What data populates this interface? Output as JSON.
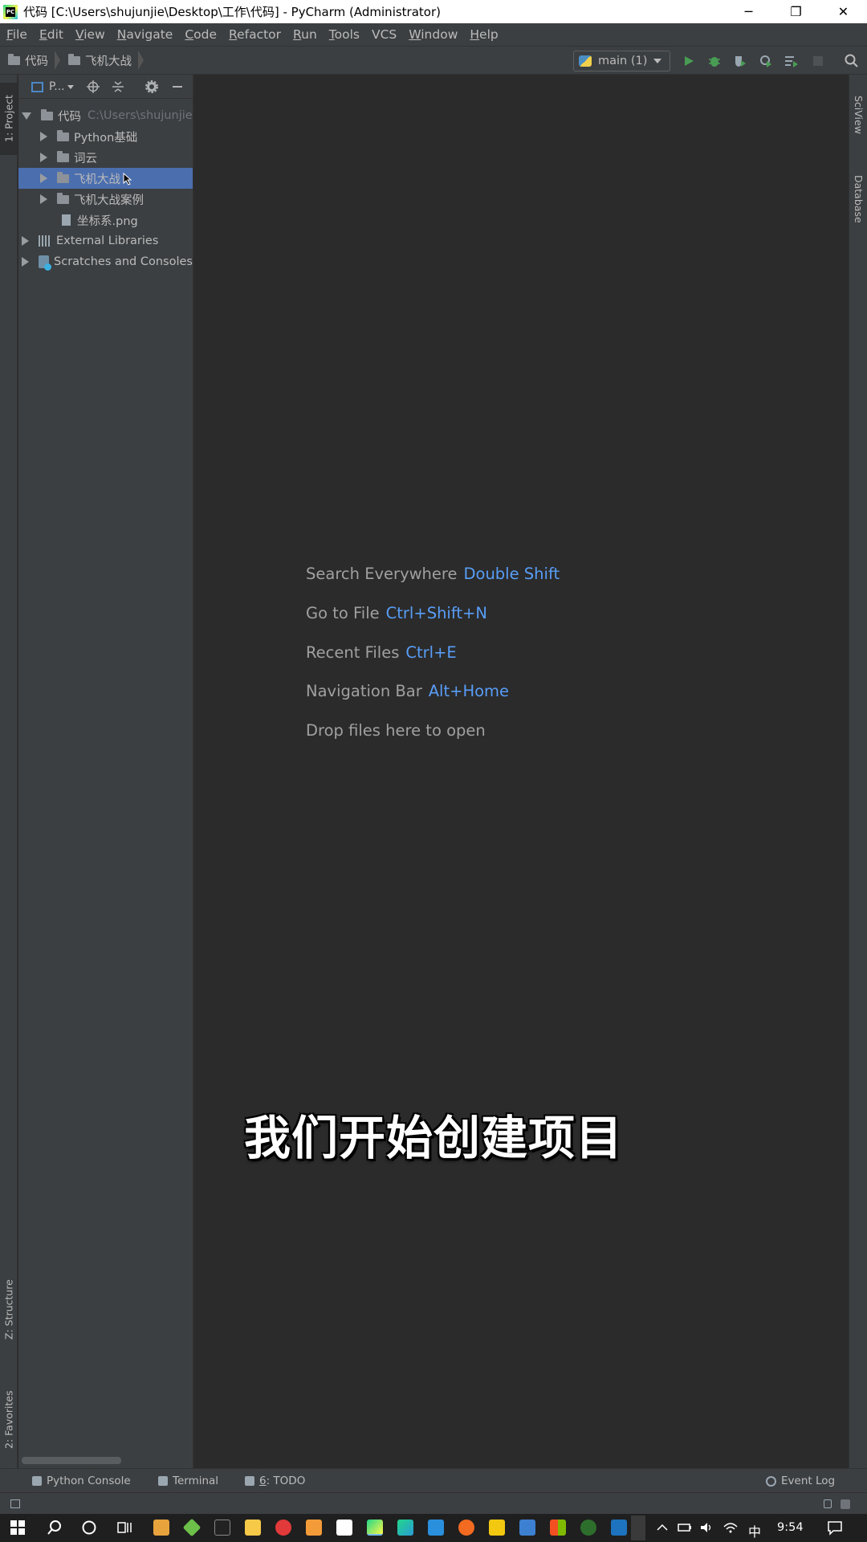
{
  "window": {
    "title": "代码 [C:\\Users\\shujunjie\\Desktop\\工作\\代码] - PyCharm (Administrator)",
    "minimize": "─",
    "restore": "❐",
    "close": "✕"
  },
  "menu": [
    {
      "mn": "F",
      "rest": "ile"
    },
    {
      "mn": "E",
      "rest": "dit"
    },
    {
      "mn": "V",
      "rest": "iew"
    },
    {
      "mn": "N",
      "rest": "avigate"
    },
    {
      "mn": "C",
      "rest": "ode"
    },
    {
      "mn": "R",
      "rest": "efactor"
    },
    {
      "mn": "R",
      "rest": "un"
    },
    {
      "mn": "T",
      "rest": "ools"
    },
    {
      "mn": "VCS",
      "rest": ""
    },
    {
      "mn": "W",
      "rest": "indow"
    },
    {
      "mn": "H",
      "rest": "elp"
    }
  ],
  "breadcrumb": [
    "代码",
    "飞机大战"
  ],
  "run_config": "main (1)",
  "left_tabs": {
    "project": "1: Project",
    "structure": "Z: Structure",
    "favorites": "2: Favorites"
  },
  "right_tabs": {
    "sciview": "SciView",
    "database": "Database"
  },
  "panel": {
    "title": "P..."
  },
  "tree": {
    "root_name": "代码",
    "root_path": "C:\\Users\\shujunjie",
    "items": [
      "Python基础",
      "词云",
      "飞机大战",
      "飞机大战案例"
    ],
    "file": "坐标系.png",
    "external": "External Libraries",
    "scratches": "Scratches and Consoles"
  },
  "hints": [
    {
      "label": "Search Everywhere",
      "key": "Double Shift"
    },
    {
      "label": "Go to File",
      "key": "Ctrl+Shift+N"
    },
    {
      "label": "Recent Files",
      "key": "Ctrl+E"
    },
    {
      "label": "Navigation Bar",
      "key": "Alt+Home"
    },
    {
      "label": "Drop files here to open",
      "key": ""
    }
  ],
  "subtitle": "我们开始创建项目",
  "bottom_tabs": {
    "python_console": "Python Console",
    "terminal": "Terminal",
    "todo_num": "6",
    "todo_rest": ": TODO",
    "event_log": "Event Log"
  },
  "taskbar": {
    "ime": "中",
    "time": "9:54"
  },
  "colors": {
    "selection": "#4b6eaf",
    "shortcut": "#589df6",
    "run_green": "#499c54"
  }
}
